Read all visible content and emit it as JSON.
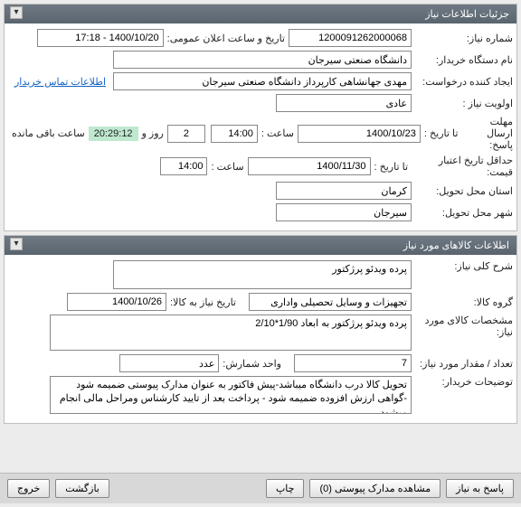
{
  "panel1": {
    "title": "جزئیات اطلاعات نیاز",
    "need_no_label": "شماره نیاز:",
    "need_no": "1200091262000068",
    "announce_label": "تاریخ و ساعت اعلان عمومی:",
    "announce_value": "1400/10/20 - 17:18",
    "buyer_label": "نام دستگاه خریدار:",
    "buyer_value": "دانشگاه صنعتی سیرجان",
    "requester_label": "ایجاد کننده درخواست:",
    "requester_value": "مهدی جهانشاهی کارپرداز دانشگاه صنعتی سیرجان",
    "contact_link": "اطلاعات تماس خریدار",
    "priority_label": "اولویت نیاز :",
    "priority_value": "عادی",
    "reply_deadline_label": "مهلت ارسال پاسخ:",
    "to_date_label": "تا تاریخ :",
    "reply_date": "1400/10/23",
    "time_label": "ساعت :",
    "reply_time": "14:00",
    "days": "2",
    "days_label": "روز و",
    "countdown": "20:29:12",
    "remain_label": "ساعت باقی مانده",
    "min_valid_label": "حداقل تاریخ اعتبار قیمت:",
    "valid_date": "1400/11/30",
    "valid_time": "14:00",
    "province_label": "استان محل تحویل:",
    "province_value": "کرمان",
    "city_label": "شهر محل تحویل:",
    "city_value": "سیرجان"
  },
  "panel2": {
    "title": "اطلاعات کالاهای مورد نیاز",
    "desc_label": "شرح کلی نیاز:",
    "desc_value": "پرده ویدئو پرژکتور",
    "group_label": "گروه کالا:",
    "group_value": "تجهیزات و وسایل تحصیلی واداری",
    "need_date_label": "تاریخ نیاز به کالا:",
    "need_date": "1400/10/26",
    "spec_label": "مشخصات کالای مورد نیاز:",
    "spec_value": "پرده ویدئو پرژکتور به ابعاد 1/90*2/10",
    "qty_label": "تعداد / مقدار مورد نیاز:",
    "qty_value": "7",
    "unit_label": "واحد شمارش:",
    "unit_value": "عدد",
    "buyer_notes_label": "توضیحات خریدار:",
    "buyer_notes_value": "تحویل کالا درب دانشگاه میباشد-پیش فاکتور به عنوان مدارک پیوستی ضمیمه شود -گواهی ارزش افزوده ضمیمه شود - پرداخت بعد از تایید کارشناس ومراحل مالی انجام میشود"
  },
  "footer": {
    "reply_btn": "پاسخ به نیاز",
    "attach_btn": "مشاهده مدارک پیوستی (0)",
    "print_btn": "چاپ",
    "back_btn": "بازگشت",
    "exit_btn": "خروج"
  }
}
